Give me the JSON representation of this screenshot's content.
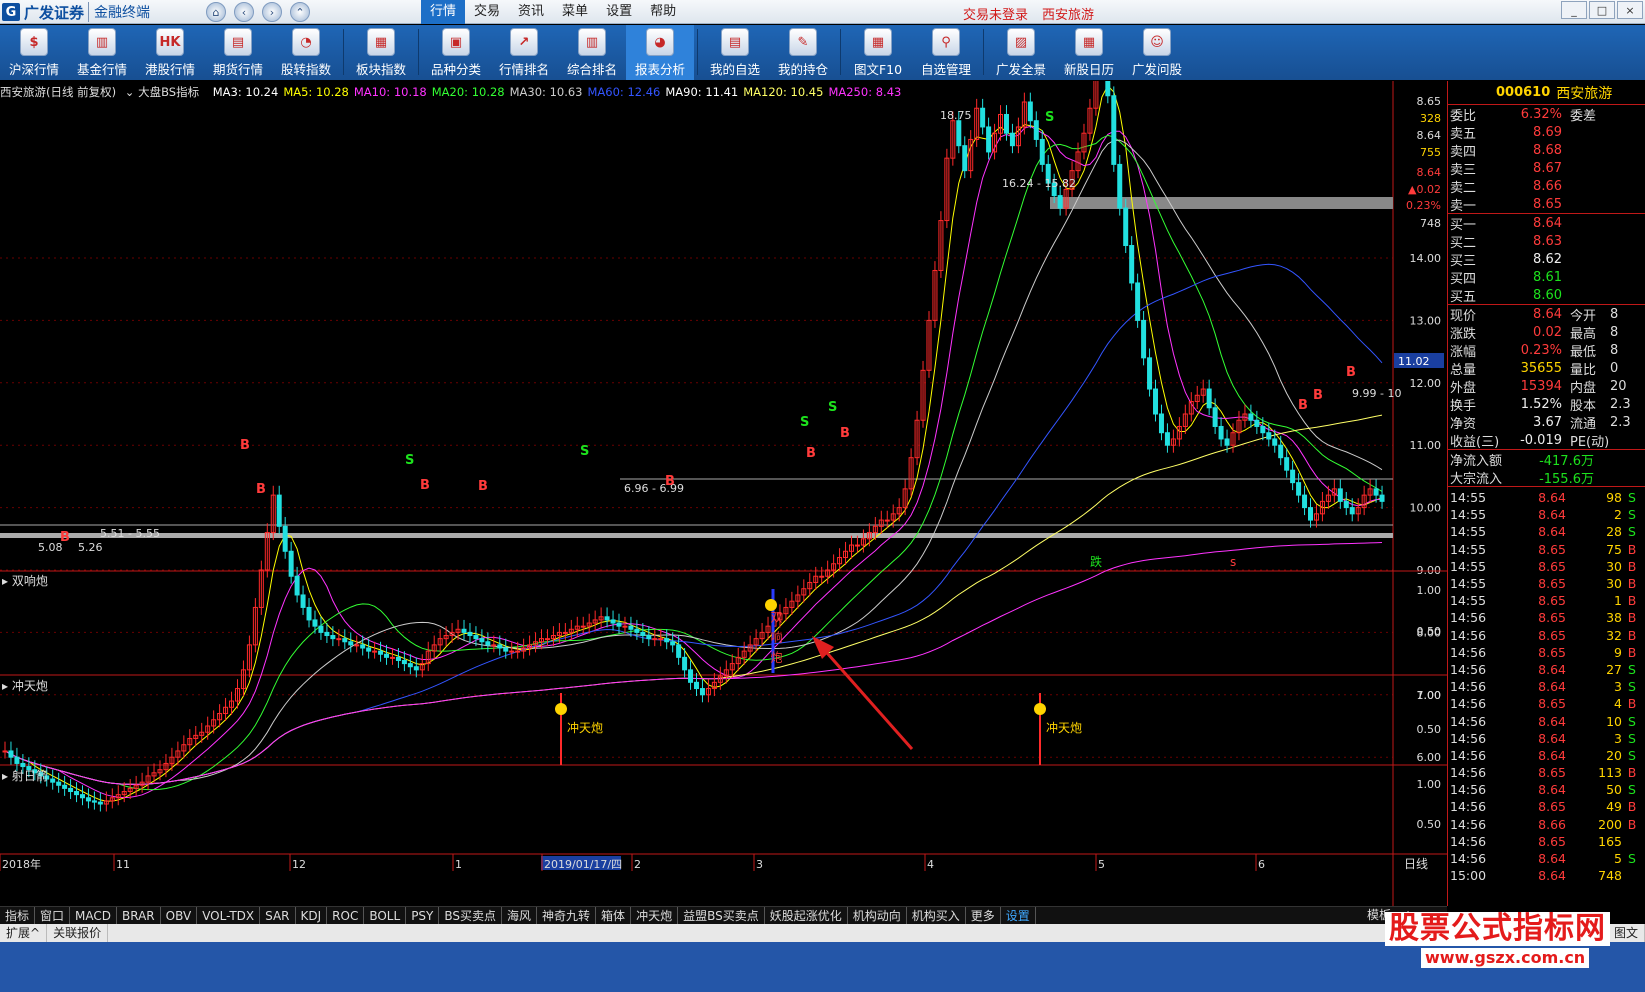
{
  "title": {
    "brand": "广发证券",
    "product": "金融终端",
    "icons": [
      "home-icon",
      "back-icon",
      "forward-icon",
      "collapse-icon"
    ]
  },
  "menu": [
    {
      "label": "行情"
    },
    {
      "label": "交易"
    },
    {
      "label": "资讯"
    },
    {
      "label": "菜单"
    },
    {
      "label": "设置"
    },
    {
      "label": "帮助"
    }
  ],
  "status": {
    "trade": "交易未登录",
    "stock": "西安旅游"
  },
  "window_buttons": [
    "_",
    "□",
    "×"
  ],
  "toolbar": [
    {
      "label": "沪深行情",
      "icon": "$"
    },
    {
      "label": "基金行情",
      "icon": "▥"
    },
    {
      "label": "港股行情",
      "icon": "HK"
    },
    {
      "label": "期货行情",
      "icon": "▤"
    },
    {
      "label": "股转指数",
      "icon": "◔"
    },
    {
      "label": "板块指数",
      "icon": "▦"
    },
    {
      "label": "品种分类",
      "icon": "▣"
    },
    {
      "label": "行情排名",
      "icon": "↗"
    },
    {
      "label": "综合排名",
      "icon": "▥"
    },
    {
      "label": "报表分析",
      "icon": "◕"
    },
    {
      "label": "我的自选",
      "icon": "▤"
    },
    {
      "label": "我的持仓",
      "icon": "✎"
    },
    {
      "label": "图文F10",
      "icon": "▦"
    },
    {
      "label": "自选管理",
      "icon": "⚲"
    },
    {
      "label": "广发全景",
      "icon": "▨"
    },
    {
      "label": "新股日历",
      "icon": "▦"
    },
    {
      "label": "广发问股",
      "icon": "☺"
    }
  ],
  "chart": {
    "header": "西安旅游(日线 前复权)",
    "indicator": "大盘BS指标",
    "ma": [
      {
        "label": "MA3: 10.24",
        "color": "#ffffff"
      },
      {
        "label": "MA5: 10.28",
        "color": "#ffff00"
      },
      {
        "label": "MA10: 10.18",
        "color": "#ff33ff"
      },
      {
        "label": "MA20: 10.28",
        "color": "#33ff33"
      },
      {
        "label": "MA30: 10.63",
        "color": "#cccccc"
      },
      {
        "label": "MA60: 12.46",
        "color": "#3355ff"
      },
      {
        "label": "MA90: 11.41",
        "color": "#ffffff"
      },
      {
        "label": "MA120: 10.45",
        "color": "#ffff66"
      },
      {
        "label": "MA250: 8.43",
        "color": "#ff33ff"
      }
    ],
    "price_ticks": [
      "14.00",
      "13.00",
      "12.00",
      "11.00",
      "10.00",
      "9.00",
      "8.00",
      "7.00",
      "6.00"
    ],
    "top_ticks": [
      "8.65",
      "328",
      "8.64",
      "755",
      "8.64",
      "▲0.02",
      "0.23%",
      "748"
    ],
    "current_price_label": "11.02",
    "annotations": {
      "high": "18.75",
      "box1": "16.24 - 15.82",
      "box2": "6.96 - 6.99",
      "box3": "5.51 - 5.55",
      "low": "5.08",
      "low2": "5.26",
      "right": "9.99 - 10"
    },
    "markers": {
      "die": "跌",
      "s": "s"
    },
    "panel1": {
      "title": "双响炮",
      "ticks": [
        "1.00",
        "0.50"
      ],
      "signal": "双响炮"
    },
    "panel2": {
      "title": "冲天炮",
      "ticks": [
        "1.00",
        "0.50"
      ],
      "signal": "冲天炮"
    },
    "panel3": {
      "title": "射日箭",
      "ticks": [
        "1.00",
        "0.50"
      ]
    },
    "xaxis": [
      "2018年",
      "11",
      "12",
      "1",
      "2019/01/17/四",
      "2",
      "3",
      "4",
      "5",
      "6"
    ],
    "period": "日线"
  },
  "quote": {
    "code": "000610",
    "name": "西安旅游",
    "weibi": {
      "label": "委比",
      "value": "6.32%",
      "label2": "委差"
    },
    "sells": [
      {
        "label": "卖五",
        "price": "8.69"
      },
      {
        "label": "卖四",
        "price": "8.68"
      },
      {
        "label": "卖三",
        "price": "8.67"
      },
      {
        "label": "卖二",
        "price": "8.66"
      },
      {
        "label": "卖一",
        "price": "8.65"
      }
    ],
    "buys": [
      {
        "label": "买一",
        "price": "8.64"
      },
      {
        "label": "买二",
        "price": "8.63"
      },
      {
        "label": "买三",
        "price": "8.62"
      },
      {
        "label": "买四",
        "price": "8.61"
      },
      {
        "label": "买五",
        "price": "8.60"
      }
    ],
    "stats": [
      {
        "l": "现价",
        "v": "8.64",
        "c": "red",
        "l2": "今开",
        "v2": "8"
      },
      {
        "l": "涨跌",
        "v": "0.02",
        "c": "red",
        "l2": "最高",
        "v2": "8"
      },
      {
        "l": "涨幅",
        "v": "0.23%",
        "c": "red",
        "l2": "最低",
        "v2": "8"
      },
      {
        "l": "总量",
        "v": "35655",
        "c": "yel",
        "l2": "量比",
        "v2": "0"
      },
      {
        "l": "外盘",
        "v": "15394",
        "c": "red",
        "l2": "内盘",
        "v2": "20"
      },
      {
        "l": "换手",
        "v": "1.52%",
        "c": "wht",
        "l2": "股本",
        "v2": "2.3"
      },
      {
        "l": "净资",
        "v": "3.67",
        "c": "wht",
        "l2": "流通",
        "v2": "2.3"
      },
      {
        "l": "收益(三)",
        "v": "-0.019",
        "c": "wht",
        "l2": "PE(动)",
        "v2": ""
      }
    ],
    "flows": [
      {
        "l": "净流入额",
        "v": "-417.6万"
      },
      {
        "l": "大宗流入",
        "v": "-155.6万"
      }
    ],
    "ticks": [
      {
        "t": "14:55",
        "p": "8.64",
        "q": "98",
        "s": "S"
      },
      {
        "t": "14:55",
        "p": "8.64",
        "q": "2",
        "s": "S"
      },
      {
        "t": "14:55",
        "p": "8.64",
        "q": "28",
        "s": "S"
      },
      {
        "t": "14:55",
        "p": "8.65",
        "q": "75",
        "s": "B"
      },
      {
        "t": "14:55",
        "p": "8.65",
        "q": "30",
        "s": "B"
      },
      {
        "t": "14:55",
        "p": "8.65",
        "q": "30",
        "s": "B"
      },
      {
        "t": "14:55",
        "p": "8.65",
        "q": "1",
        "s": "B"
      },
      {
        "t": "14:56",
        "p": "8.65",
        "q": "38",
        "s": "B"
      },
      {
        "t": "14:56",
        "p": "8.65",
        "q": "32",
        "s": "B"
      },
      {
        "t": "14:56",
        "p": "8.65",
        "q": "9",
        "s": "B"
      },
      {
        "t": "14:56",
        "p": "8.64",
        "q": "27",
        "s": "S"
      },
      {
        "t": "14:56",
        "p": "8.64",
        "q": "3",
        "s": "S"
      },
      {
        "t": "14:56",
        "p": "8.65",
        "q": "4",
        "s": "B"
      },
      {
        "t": "14:56",
        "p": "8.64",
        "q": "10",
        "s": "S"
      },
      {
        "t": "14:56",
        "p": "8.64",
        "q": "3",
        "s": "S"
      },
      {
        "t": "14:56",
        "p": "8.64",
        "q": "20",
        "s": "S"
      },
      {
        "t": "14:56",
        "p": "8.65",
        "q": "113",
        "s": "B"
      },
      {
        "t": "14:56",
        "p": "8.64",
        "q": "50",
        "s": "S"
      },
      {
        "t": "14:56",
        "p": "8.65",
        "q": "49",
        "s": "B"
      },
      {
        "t": "14:56",
        "p": "8.66",
        "q": "200",
        "s": "B"
      },
      {
        "t": "14:56",
        "p": "8.65",
        "q": "165",
        "s": ""
      },
      {
        "t": "14:56",
        "p": "8.64",
        "q": "5",
        "s": "S"
      },
      {
        "t": "15:00",
        "p": "8.64",
        "q": "748",
        "s": ""
      }
    ]
  },
  "bottom_tabs": [
    "指标",
    "窗口",
    "MACD",
    "BRAR",
    "OBV",
    "VOL-TDX",
    "SAR",
    "KDJ",
    "ROC",
    "BOLL",
    "PSY",
    "BS买卖点",
    "海风",
    "神奇九转",
    "箱体",
    "冲天炮",
    "益盟BS买卖点",
    "妖股起涨优化",
    "机构动向",
    "机构买入",
    "更多",
    "设置"
  ],
  "bottom_right": [
    "模板",
    "+"
  ],
  "bar2": [
    "扩展^",
    "关联报价"
  ],
  "bar2_right": "图文",
  "watermark": {
    "cn": "股票公式指标网",
    "url": "www.gszx.com.cn"
  }
}
